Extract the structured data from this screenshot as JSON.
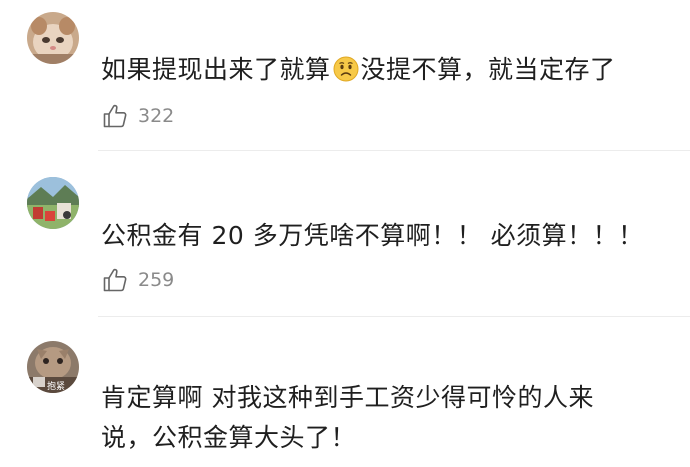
{
  "comments": [
    {
      "avatar": "cat-face-avatar",
      "text_before": "如果提现出来了就算",
      "emoji": "worried-face-emoji",
      "text_after": "没提不算，就当定存了",
      "likes": "322"
    },
    {
      "avatar": "landscape-avatar",
      "text": "公积金有 20 多万凭啥不算啊！！ 必须算！！！",
      "likes": "259"
    },
    {
      "avatar": "cat-hug-avatar",
      "avatar_caption": "抱紧",
      "text_line1": "肯定算啊 对我这种到手工资少得可怜的人来",
      "text_line2": "说，公积金算大头了！"
    }
  ],
  "colors": {
    "text": "#1f1f1f",
    "meta": "#8a8a8a",
    "divider": "#ececec"
  },
  "icons": {
    "like": "thumbs-up-icon"
  }
}
